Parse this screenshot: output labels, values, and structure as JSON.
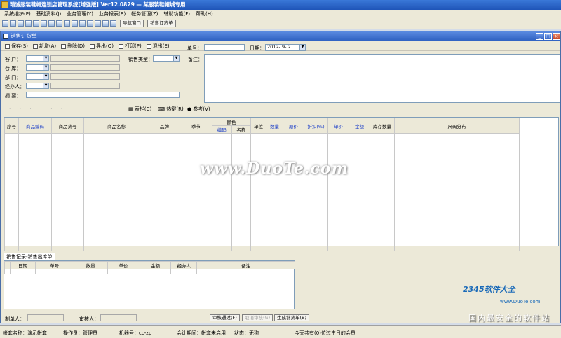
{
  "app_title": "精诚服装鞋帽连锁店管理系统[增强版] Ver12.0829 — 某服装鞋帽城专用",
  "menu": [
    "系统维护(P)",
    "基础资料(J)",
    "业务管理(Y)",
    "业务报表(B)",
    "帐务管理(Z)",
    "辅助功能(F)",
    "帮助(H)"
  ],
  "toolbar": {
    "nav_button": "导航窗口",
    "sales_order_button": "销售订货单"
  },
  "window": {
    "title": "销售订货单"
  },
  "actions": [
    "保存(S)",
    "新增(A)",
    "删除(D)",
    "导出(O)",
    "打印(P)",
    "退出(E)"
  ],
  "form": {
    "order_no_label": "单号：",
    "order_no_value": "",
    "date_label": "日期：",
    "date_value": "2012- 9- 2",
    "customer_label": "客 户：",
    "warehouse_label": "仓 库：",
    "department_label": "部 门：",
    "handler_label": "经办人：",
    "summary_label": "摘 要：",
    "sales_type_label": "销售类型：",
    "remark_label": "备注："
  },
  "grid_tools": [
    "表栏(C)",
    "热键(R)",
    "参考(V)"
  ],
  "columns": [
    "序号",
    "商品编码",
    "商品货号",
    "商品名称",
    "品牌",
    "季节",
    "颜色",
    "编码",
    "名称",
    "单位",
    "数量",
    "原价",
    "折扣(%)",
    "单价",
    "金额",
    "库存数量",
    "尺码分布"
  ],
  "sub_tab": "销售记录-销售出库单",
  "sub_columns": [
    "日期",
    "单号",
    "数量",
    "单价",
    "金额",
    "经办人",
    "备注"
  ],
  "bottom": {
    "maker_label": "制单人：",
    "auditor_label": "审核人：",
    "approve_button": "审核通过(F)",
    "unapprove_button": "取消审核(G)",
    "generate_button": "生成补货单(B)"
  },
  "status": {
    "account": "帐套名称：演示帐套",
    "operator": "操作员：管理员",
    "machine": "机器号：cc-zp",
    "period": "会计期间：帐套未启用",
    "state": "状态：无狗",
    "birthday": "今天共有(0)位过生日的会员"
  },
  "watermark": {
    "main": "www.DuoTe.com",
    "logo": "2345软件大全",
    "logo_url": "www.DuoTe.com",
    "footer": "国内最安全的软件站"
  }
}
